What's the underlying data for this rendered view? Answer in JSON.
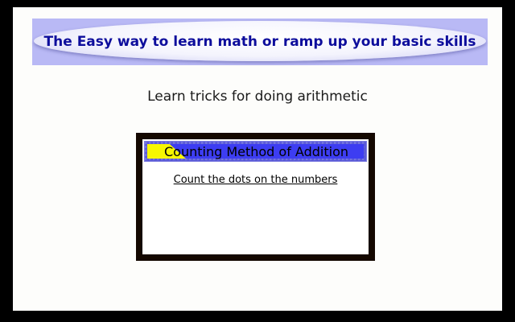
{
  "banner": {
    "title": "The Easy way to learn math or ramp up your basic skills"
  },
  "subtitle": "Learn tricks for doing arithmetic",
  "lesson_card": {
    "title": "Counting Method of Addition",
    "link": "Count the dots on the numbers"
  },
  "colors": {
    "banner_background": "#b9b9f5",
    "banner_text": "#0d0d9c",
    "card_border": "#140800",
    "card_header": "#3d3df2",
    "tab_flag": "#f7f700"
  }
}
